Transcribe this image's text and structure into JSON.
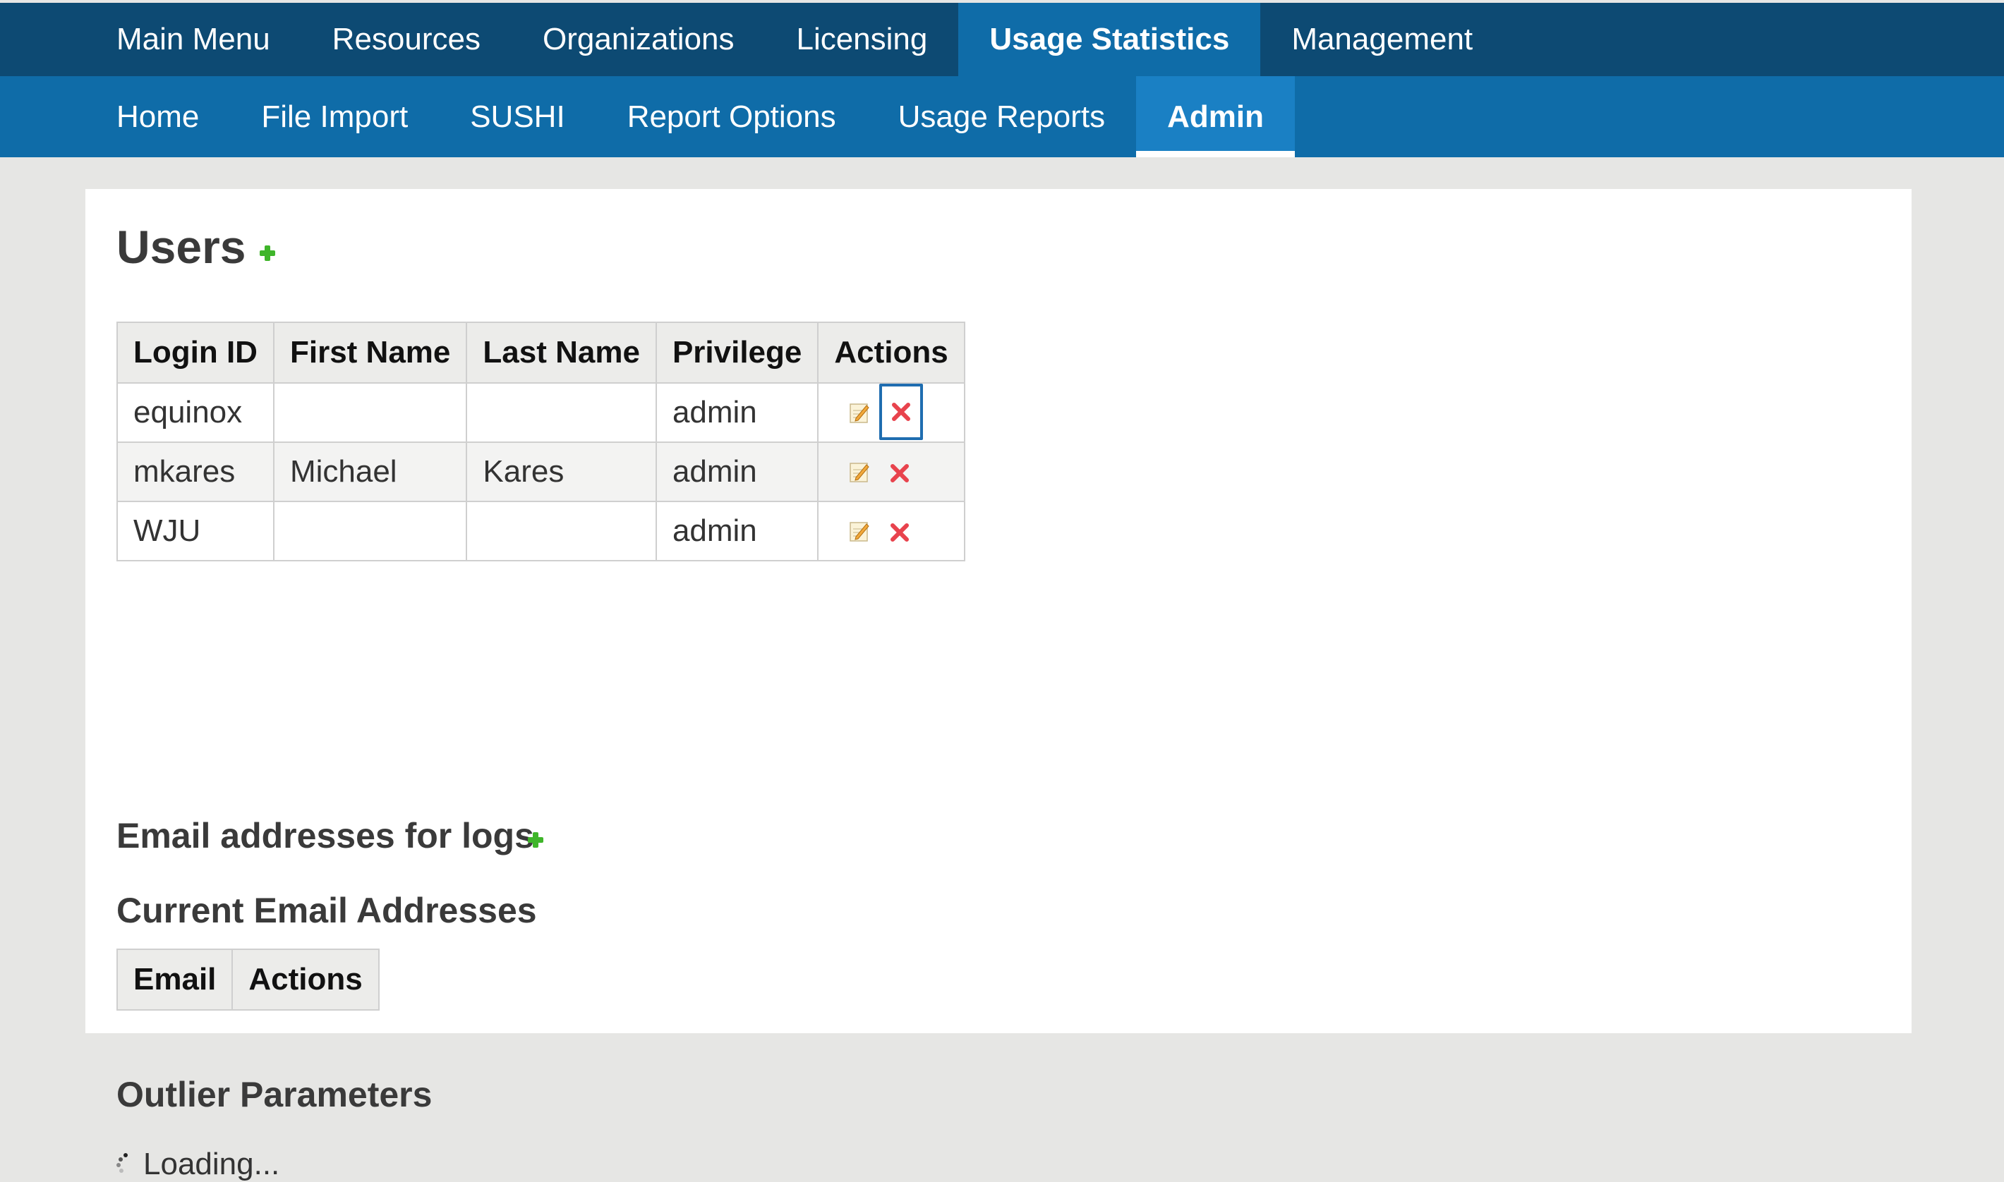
{
  "nav": {
    "primary": [
      {
        "label": "Main Menu"
      },
      {
        "label": "Resources"
      },
      {
        "label": "Organizations"
      },
      {
        "label": "Licensing"
      },
      {
        "label": "Usage Statistics",
        "active": true
      },
      {
        "label": "Management"
      }
    ],
    "secondary": [
      {
        "label": "Home"
      },
      {
        "label": "File Import"
      },
      {
        "label": "SUSHI"
      },
      {
        "label": "Report Options"
      },
      {
        "label": "Usage Reports"
      },
      {
        "label": "Admin",
        "active": true
      }
    ]
  },
  "users": {
    "title": "Users",
    "add_icon": "plus-icon",
    "columns": [
      "Login ID",
      "First Name",
      "Last Name",
      "Privilege",
      "Actions"
    ],
    "rows": [
      {
        "login": "equinox",
        "first": "",
        "last": "",
        "privilege": "admin"
      },
      {
        "login": "mkares",
        "first": "Michael",
        "last": "Kares",
        "privilege": "admin"
      },
      {
        "login": "WJU",
        "first": "",
        "last": "",
        "privilege": "admin"
      }
    ],
    "row_actions": [
      "edit-icon",
      "delete-icon"
    ]
  },
  "email_logs": {
    "title": "Email addresses for logs",
    "add_icon": "plus-icon",
    "subtitle": "Current Email Addresses",
    "columns": [
      "Email",
      "Actions"
    ]
  },
  "outlier": {
    "title": "Outlier Parameters",
    "loading_text": "Loading..."
  },
  "colors": {
    "nav_primary_bg": "#0d4a73",
    "nav_secondary_bg": "#0f6ca8",
    "add_icon": "#3fb52a",
    "delete_icon": "#e8434d"
  }
}
